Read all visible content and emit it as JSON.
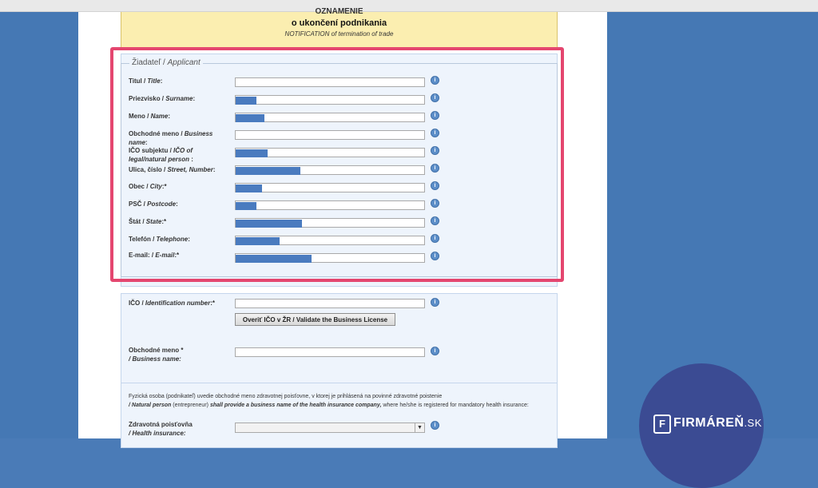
{
  "header": {
    "cut_text": "OZNÁMENIE",
    "title": "o ukončení podnikania",
    "subtitle": "NOTIFICATION of termination of trade"
  },
  "applicant": {
    "legend_sk": "Žiadateľ / ",
    "legend_en": "Applicant",
    "fields": [
      {
        "label_sk": "Titul / ",
        "label_en": "Title",
        "label_tail": ":",
        "value": "",
        "redacted": false,
        "redaction_fraction": 0
      },
      {
        "label_sk": "Priezvisko / ",
        "label_en": "Surname",
        "label_tail": ":",
        "value": "",
        "redacted": true,
        "redaction_fraction": 0.11
      },
      {
        "label_sk": "Meno / ",
        "label_en": "Name",
        "label_tail": ":",
        "value": "",
        "redacted": true,
        "redaction_fraction": 0.15
      },
      {
        "label_sk": "Obchodné meno / ",
        "label_en": "Business name",
        "label_tail": ":",
        "value": "",
        "redacted": false,
        "redaction_fraction": 0
      },
      {
        "label_sk": "IČO subjektu / ",
        "label_en": "IČO of legal/natural person",
        "label_tail": " :",
        "value": "",
        "redacted": true,
        "redaction_fraction": 0.17
      },
      {
        "label_sk": "Ulica, číslo / ",
        "label_en": "Street, Number",
        "label_tail": ":",
        "value": "",
        "redacted": true,
        "redaction_fraction": 0.34
      },
      {
        "label_sk": "Obec / ",
        "label_en": "City",
        "label_tail": ":*",
        "value": "",
        "redacted": true,
        "redaction_fraction": 0.14
      },
      {
        "label_sk": "PSČ / ",
        "label_en": "Postcode",
        "label_tail": ":",
        "value": "",
        "redacted": true,
        "redaction_fraction": 0.11
      },
      {
        "label_sk": "Štát / ",
        "label_en": "State",
        "label_tail": ":*",
        "value": "",
        "redacted": true,
        "redaction_fraction": 0.35
      },
      {
        "label_sk": "Telefón / ",
        "label_en": "Telephone",
        "label_tail": ":",
        "value": "",
        "redacted": true,
        "redaction_fraction": 0.23
      },
      {
        "label_sk": "E-mail: / ",
        "label_en": "E-mail",
        "label_tail": ":*",
        "value": "",
        "redacted": true,
        "redaction_fraction": 0.4
      }
    ]
  },
  "ico_section": {
    "label_sk": "IČO / ",
    "label_en": "Identification number",
    "label_tail": ":*",
    "validate_button": "Overiť IČO v ŽR / Validate the Business License",
    "business_label_sk": "Obchodné meno *",
    "business_label_en": "/ Business name:"
  },
  "insurance": {
    "note_sk": "Fyzická osoba (podnikateľ) uvedie obchodné meno zdravotnej poisťovne, v ktorej je prihlásená na povinné zdravotné poistenie",
    "note_en_1": "/ Natural person",
    "note_en_2": " (entrepreneur) ",
    "note_en_3": "shall provide a business name of the health insurance company,",
    "note_en_4": " where he/she is registered for mandatory health insurance:",
    "label_sk": "Zdravotná poisťovňa",
    "label_en": "/ Health insurance:",
    "selected": ""
  },
  "brand": {
    "name": "FIRMÁREŇ",
    "suffix": ".SK",
    "logo_letter": "F"
  },
  "icons": {
    "info": "info-icon",
    "select_arrow": "chevron-down-icon"
  },
  "colors": {
    "highlight": "#e4466f",
    "redaction": "#4a7bbf",
    "background": "#4578b4",
    "header": "#fbeeb0"
  }
}
